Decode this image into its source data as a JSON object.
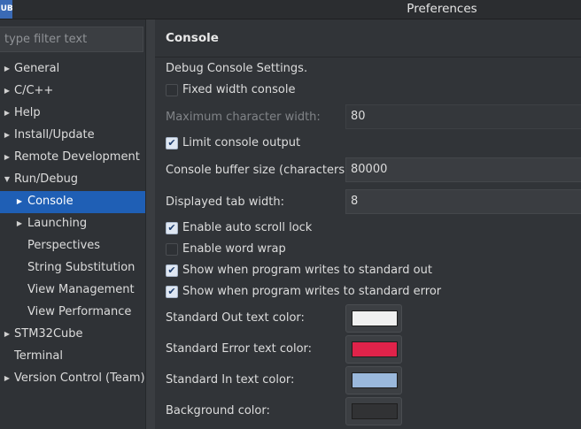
{
  "app": {
    "badge": "CUBE"
  },
  "window": {
    "title": "Preferences"
  },
  "filter": {
    "placeholder": "type filter text",
    "value": ""
  },
  "tree": [
    {
      "label": "General",
      "depth": 0,
      "arrow": "collapsed",
      "selected": false
    },
    {
      "label": "C/C++",
      "depth": 0,
      "arrow": "collapsed",
      "selected": false
    },
    {
      "label": "Help",
      "depth": 0,
      "arrow": "collapsed",
      "selected": false
    },
    {
      "label": "Install/Update",
      "depth": 0,
      "arrow": "collapsed",
      "selected": false
    },
    {
      "label": "Remote Development",
      "depth": 0,
      "arrow": "collapsed",
      "selected": false
    },
    {
      "label": "Run/Debug",
      "depth": 0,
      "arrow": "expanded",
      "selected": false
    },
    {
      "label": "Console",
      "depth": 1,
      "arrow": "collapsed",
      "selected": true
    },
    {
      "label": "Launching",
      "depth": 1,
      "arrow": "collapsed",
      "selected": false
    },
    {
      "label": "Perspectives",
      "depth": 1,
      "arrow": "none",
      "selected": false
    },
    {
      "label": "String Substitution",
      "depth": 1,
      "arrow": "none",
      "selected": false
    },
    {
      "label": "View Management",
      "depth": 1,
      "arrow": "none",
      "selected": false
    },
    {
      "label": "View Performance",
      "depth": 1,
      "arrow": "none",
      "selected": false
    },
    {
      "label": "STM32Cube",
      "depth": 0,
      "arrow": "collapsed",
      "selected": false
    },
    {
      "label": "Terminal",
      "depth": 0,
      "arrow": "none",
      "selected": false
    },
    {
      "label": "Version Control (Team)",
      "depth": 0,
      "arrow": "collapsed",
      "selected": false
    }
  ],
  "page": {
    "title": "Console",
    "section_label": "Debug Console Settings.",
    "fixed_width": {
      "label": "Fixed width console",
      "checked": false
    },
    "max_char_width": {
      "label": "Maximum character width:",
      "value": "80",
      "enabled": false
    },
    "limit_output": {
      "label": "Limit console output",
      "checked": true
    },
    "buffer_size": {
      "label": "Console buffer size (characters):",
      "value": "80000"
    },
    "tab_width": {
      "label": "Displayed tab width:",
      "value": "8"
    },
    "auto_scroll": {
      "label": "Enable auto scroll lock",
      "checked": true
    },
    "word_wrap": {
      "label": "Enable word wrap",
      "checked": false
    },
    "show_stdout": {
      "label": "Show when program writes to standard out",
      "checked": true
    },
    "show_stderr": {
      "label": "Show when program writes to standard error",
      "checked": true
    },
    "colors": [
      {
        "label": "Standard Out text color:",
        "color": "#f0f0f0"
      },
      {
        "label": "Standard Error text color:",
        "color": "#e0234a"
      },
      {
        "label": "Standard In text color:",
        "color": "#9ab8dc"
      },
      {
        "label": "Background color:",
        "color": "#313234"
      }
    ]
  },
  "icons": {
    "collapsed": "chevron-right-icon",
    "expanded": "chevron-down-icon",
    "check": "checkmark-icon"
  }
}
